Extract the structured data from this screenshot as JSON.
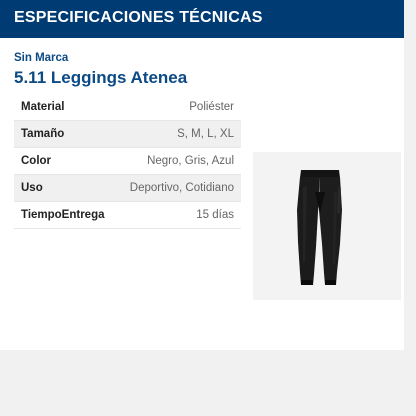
{
  "header": {
    "title": "ESPECIFICACIONES TÉCNICAS"
  },
  "product": {
    "brand": "Sin Marca",
    "title": "5.11 Leggings Atenea"
  },
  "specs": [
    {
      "label": "Material",
      "value": "Poliéster"
    },
    {
      "label": "Tamaño",
      "value": "S, M, L, XL"
    },
    {
      "label": "Color",
      "value": "Negro, Gris, Azul"
    },
    {
      "label": "Uso",
      "value": "Deportivo, Cotidiano"
    },
    {
      "label": "TiempoEntrega",
      "value": "15 días"
    }
  ],
  "colors": {
    "header_bg": "#003b73",
    "title_blue": "#0c4a86",
    "page_bg": "#f1f1f1"
  },
  "image": {
    "icon": "leggings-product-photo"
  }
}
